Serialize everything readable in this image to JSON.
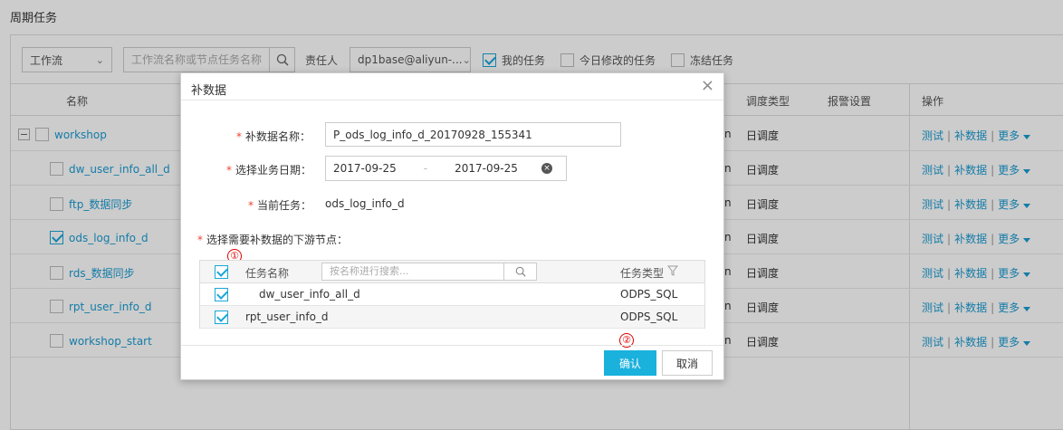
{
  "page": {
    "title": "周期任务"
  },
  "toolbar": {
    "type_select": "工作流",
    "search_placeholder": "工作流名称或节点任务名称",
    "owner_label": "责任人",
    "owner_select": "dp1base@aliyun-...",
    "my_tasks": "我的任务",
    "today_modified": "今日修改的任务",
    "frozen": "冻结任务"
  },
  "grid": {
    "headers": {
      "name": "名称",
      "schedule_type": "调度类型",
      "alarm": "报警设置",
      "ops": "操作"
    },
    "rows": [
      {
        "name": "workshop",
        "n": "n",
        "type": "日调度"
      },
      {
        "name": "dw_user_info_all_d",
        "n": "n",
        "type": "日调度"
      },
      {
        "name": "ftp_数据同步",
        "n": "n",
        "type": "日调度"
      },
      {
        "name": "ods_log_info_d",
        "n": "n",
        "type": "日调度"
      },
      {
        "name": "rds_数据同步",
        "n": "n",
        "type": "日调度"
      },
      {
        "name": "rpt_user_info_d",
        "n": "n",
        "type": "日调度"
      },
      {
        "name": "workshop_start",
        "n": "n",
        "type": "日调度"
      }
    ],
    "ops": {
      "test": "测试",
      "backfill": "补数据",
      "more": "更多",
      "sep": "|"
    }
  },
  "dialog": {
    "title": "补数据",
    "close": "×",
    "name_label": "补数据名称：",
    "name_value": "P_ods_log_info_d_20170928_155341",
    "date_label": "选择业务日期：",
    "date_start": "2017-09-25",
    "date_sep": "-",
    "date_end": "2017-09-25",
    "clear": "×",
    "current_label": "当前任务：",
    "current_value": "ods_log_info_d",
    "downstream_label": "选择需要补数据的下游节点：",
    "marker1": "①",
    "marker2": "②",
    "table": {
      "col_name": "任务名称",
      "search_placeholder": "按名称进行搜索...",
      "col_type": "任务类型",
      "rows": [
        {
          "name": "dw_user_info_all_d",
          "type": "ODPS_SQL"
        },
        {
          "name": "rpt_user_info_d",
          "type": "ODPS_SQL"
        }
      ]
    },
    "ok": "确认",
    "cancel": "取消"
  },
  "colors": {
    "accent": "#1ab1dc",
    "link": "#1a9bd2",
    "required": "#e43"
  }
}
